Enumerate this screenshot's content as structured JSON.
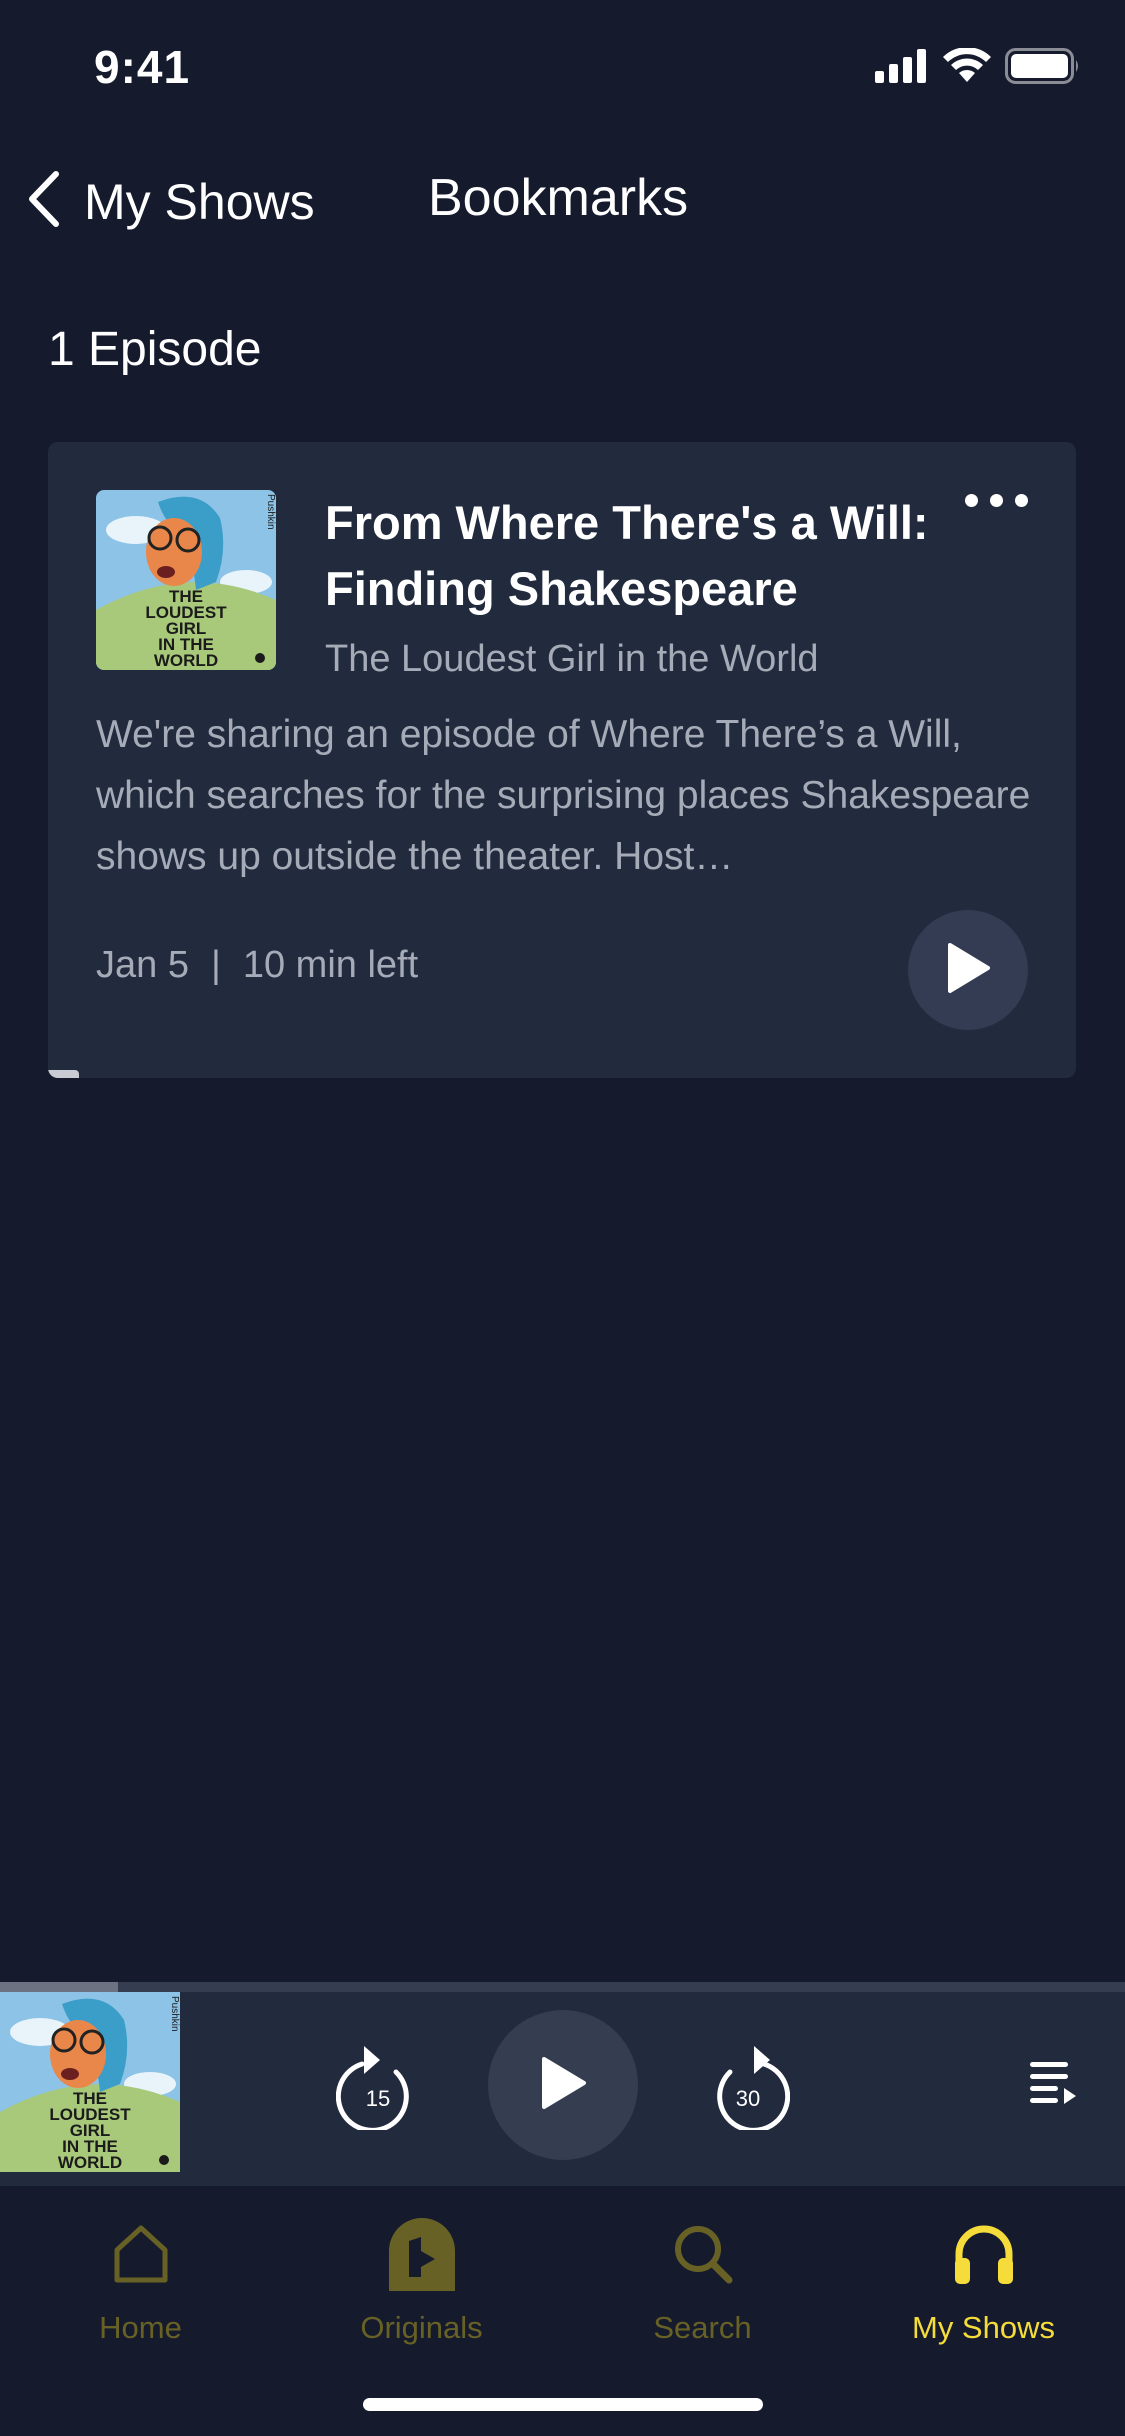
{
  "status_bar": {
    "time": "9:41"
  },
  "nav": {
    "back_label": "My Shows",
    "title": "Bookmarks"
  },
  "episodes": {
    "count_label": "1 Episode",
    "items": [
      {
        "title": "From Where There's a Will: Finding Shakespeare",
        "show": "The Loudest Girl in the World",
        "description": "We're sharing an episode of Where There’s a Will, which searches for the surprising places Shakespeare shows up outside the theater. Host…",
        "date": "Jan 5",
        "separator": "|",
        "time_left": "10 min left",
        "progress_fraction": 0.03,
        "artwork": {
          "lines": [
            "THE",
            "LOUDEST",
            "GIRL",
            "IN THE",
            "WORLD"
          ],
          "side_text": "Pushkin"
        }
      }
    ]
  },
  "mini_player": {
    "progress_fraction": 0.105,
    "rewind_seconds": "15",
    "forward_seconds": "30",
    "artwork": {
      "lines": [
        "THE",
        "LOUDEST",
        "GIRL",
        "IN THE",
        "WORLD"
      ],
      "side_text": "Pushkin"
    }
  },
  "tabs": [
    {
      "label": "Home",
      "icon": "home-icon",
      "active": false
    },
    {
      "label": "Originals",
      "icon": "originals-icon",
      "active": false
    },
    {
      "label": "Search",
      "icon": "search-icon",
      "active": false
    },
    {
      "label": "My Shows",
      "icon": "headphones-icon",
      "active": true
    }
  ],
  "colors": {
    "background": "#151b2d",
    "card": "#222a3d",
    "accent_active": "#f5dc3a",
    "accent_inactive": "#686125",
    "secondary_text": "#a6abb8"
  }
}
